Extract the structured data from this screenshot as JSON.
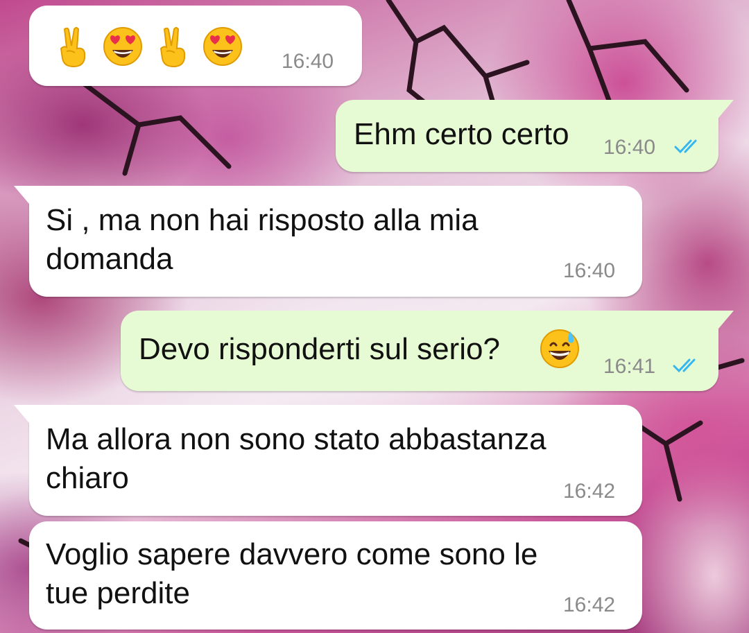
{
  "messages": [
    {
      "id": "m1",
      "direction": "incoming",
      "text": "",
      "emoji": [
        "victory-hand",
        "heart-eyes-face",
        "victory-hand",
        "heart-eyes-face"
      ],
      "time": "16:40"
    },
    {
      "id": "m2",
      "direction": "outgoing",
      "text": "Ehm certo certo",
      "time": "16:40",
      "status": "read"
    },
    {
      "id": "m3",
      "direction": "incoming",
      "text": "Si , ma non hai risposto alla mia\ndomanda",
      "time": "16:40"
    },
    {
      "id": "m4",
      "direction": "outgoing",
      "text": "Devo risponderti sul serio?",
      "emoji": [
        "grinning-sweat-face"
      ],
      "time": "16:41",
      "status": "read"
    },
    {
      "id": "m5",
      "direction": "incoming",
      "text": "Ma allora non sono stato abbastanza\nchiaro",
      "time": "16:42"
    },
    {
      "id": "m6",
      "direction": "incoming",
      "text": "Voglio sapere davvero come sono le\ntue perdite",
      "time": "16:42"
    }
  ],
  "colors": {
    "incoming_bubble": "#ffffff",
    "outgoing_bubble": "#e6fbd4",
    "timestamp": "#8a8a8a",
    "read_ticks": "#34b7f1"
  }
}
